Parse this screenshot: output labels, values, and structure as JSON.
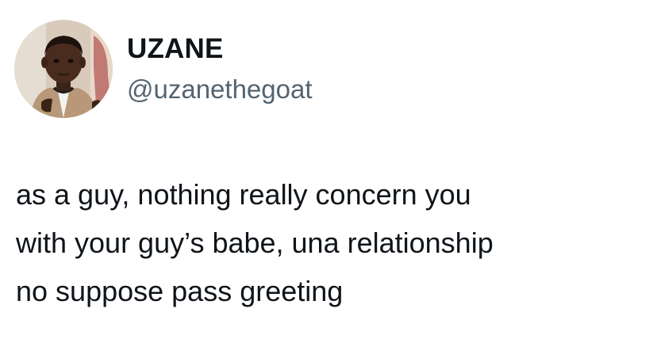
{
  "author": {
    "display_name": "UZANE",
    "handle": "@uzanethegoat",
    "avatar_icon": "profile-photo-child-icon"
  },
  "tweet": {
    "lines": [
      "as a guy, nothing really concern you",
      "with your guy’s babe, una relationship",
      "no suppose pass greeting"
    ]
  },
  "colors": {
    "text_primary": "#0f1419",
    "text_secondary": "#536471",
    "background": "#ffffff"
  }
}
